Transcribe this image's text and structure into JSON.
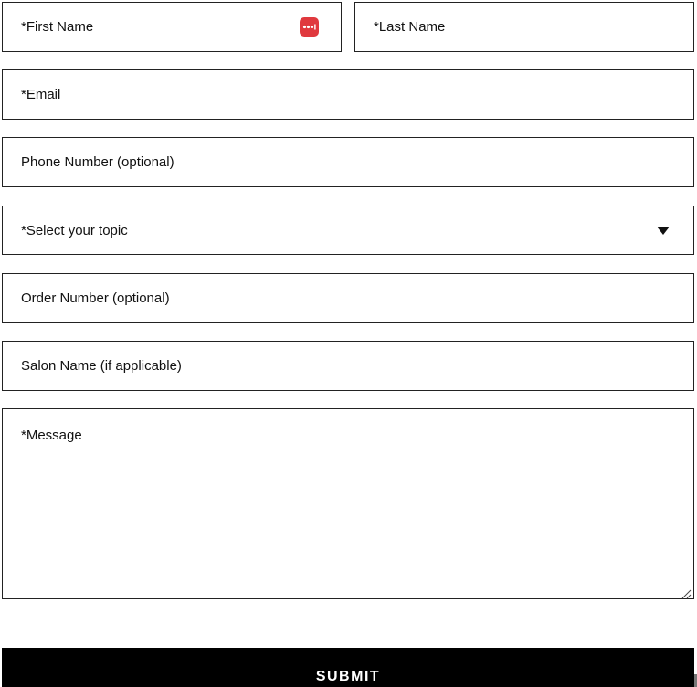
{
  "form": {
    "first_name": {
      "placeholder": "*First Name"
    },
    "last_name": {
      "placeholder": "*Last Name"
    },
    "email": {
      "placeholder": "*Email"
    },
    "phone": {
      "placeholder": "Phone Number (optional)"
    },
    "topic": {
      "selected_label": "*Select your topic"
    },
    "order_number": {
      "placeholder": "Order Number (optional)"
    },
    "salon_name": {
      "placeholder": "Salon Name (if applicable)"
    },
    "message": {
      "placeholder": "*Message"
    },
    "submit_label": "SUBMIT"
  },
  "icons": {
    "autofill": "password-manager-icon",
    "dropdown": "caret-down-icon",
    "resize": "resize-handle-icon"
  },
  "colors": {
    "border": "#222222",
    "autofill_icon": "#e0393e",
    "submit_background": "#000000",
    "submit_text": "#ffffff"
  }
}
